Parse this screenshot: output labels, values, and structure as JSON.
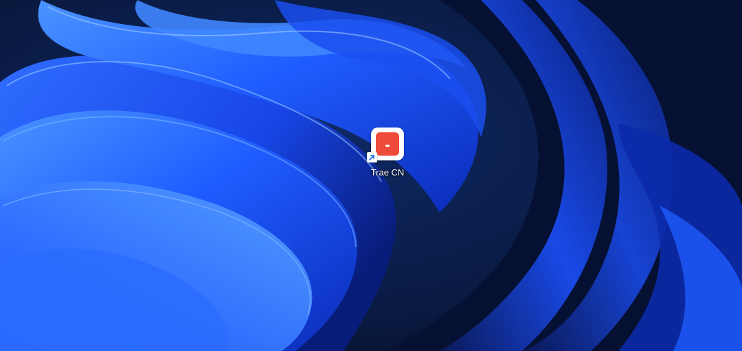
{
  "desktop": {
    "colors": {
      "background": "#0b1a33",
      "wallpaper_blue": "#1f5cff",
      "wallpaper_light": "#3f8cff",
      "wallpaper_dark": "#061033"
    },
    "icons": [
      {
        "label": "Trae CN",
        "icon": "trae-app-icon",
        "shortcut_overlay": "shortcut-arrow-icon",
        "accent_color": "#ef4b3a"
      }
    ]
  }
}
